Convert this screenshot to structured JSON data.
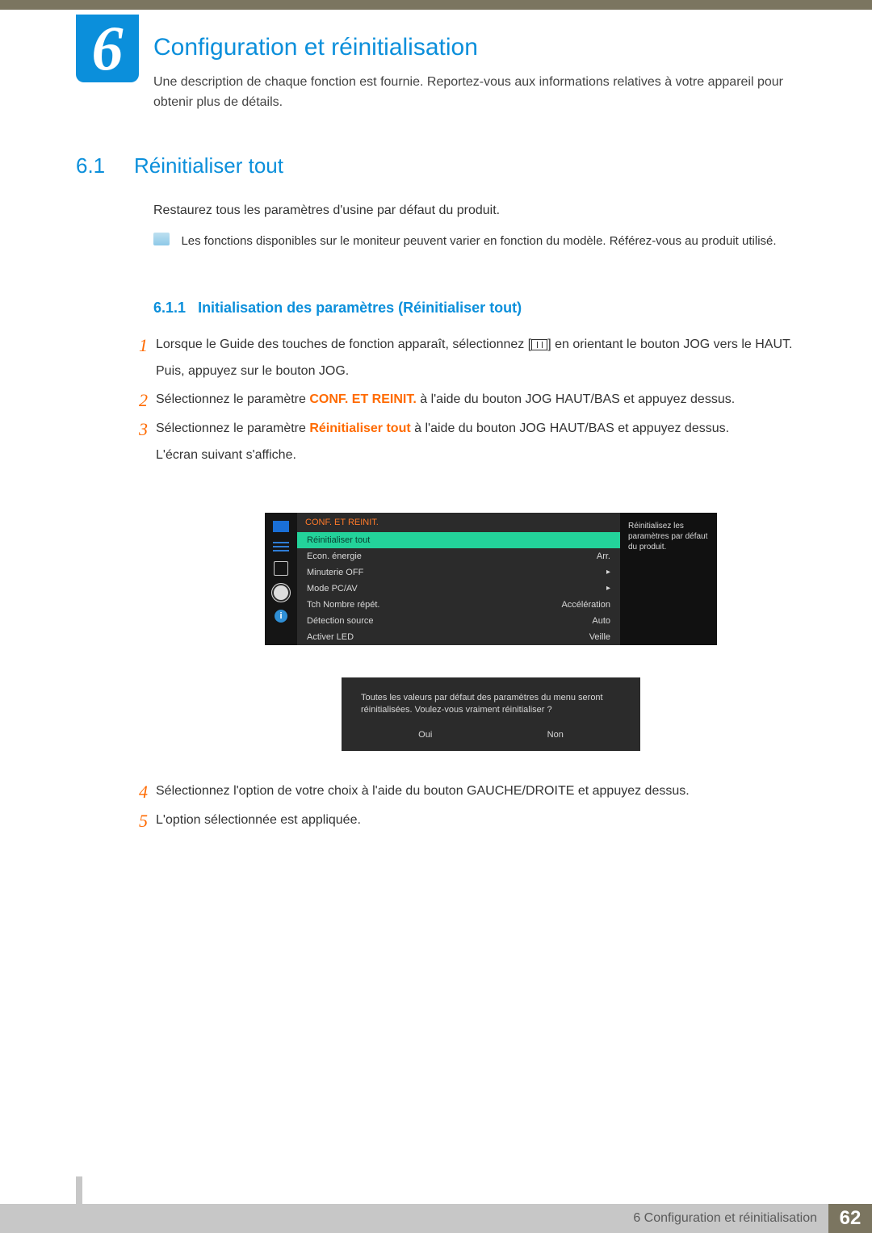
{
  "chapter": {
    "number": "6",
    "title": "Configuration et réinitialisation",
    "description": "Une description de chaque fonction est fournie. Reportez-vous aux informations relatives à votre appareil pour obtenir plus de détails."
  },
  "section": {
    "number": "6.1",
    "title": "Réinitialiser tout",
    "description": "Restaurez tous les paramètres d'usine par défaut du produit.",
    "note": "Les fonctions disponibles sur le moniteur peuvent varier en fonction du modèle. Référez-vous au produit utilisé."
  },
  "subsection": {
    "number": "6.1.1",
    "title": "Initialisation des paramètres (Réinitialiser tout)"
  },
  "steps": {
    "s1a": "Lorsque le Guide des touches de fonction apparaît, sélectionnez [",
    "s1b": "] en orientant le bouton JOG vers le HAUT.",
    "s1c": "Puis, appuyez sur le bouton JOG.",
    "s2a": "Sélectionnez le paramètre ",
    "s2b": "CONF. ET REINIT.",
    "s2c": " à l'aide du bouton JOG HAUT/BAS et appuyez dessus.",
    "s3a": "Sélectionnez le paramètre ",
    "s3b": "Réinitialiser tout",
    "s3c": " à l'aide du bouton JOG HAUT/BAS et appuyez dessus.",
    "s3d": "L'écran suivant s'affiche.",
    "s4": "Sélectionnez l'option de votre choix à l'aide du bouton GAUCHE/DROITE et appuyez dessus.",
    "s5": "L'option sélectionnée est appliquée."
  },
  "osd": {
    "header": "CONF. ET REINIT.",
    "rows": [
      {
        "label": "Réinitialiser tout",
        "value": ""
      },
      {
        "label": "Econ. énergie",
        "value": "Arr."
      },
      {
        "label": "Minuterie OFF",
        "value": "▸"
      },
      {
        "label": "Mode PC/AV",
        "value": "▸"
      },
      {
        "label": "Tch Nombre répét.",
        "value": "Accélération"
      },
      {
        "label": "Détection source",
        "value": "Auto"
      },
      {
        "label": "Activer LED",
        "value": "Veille"
      }
    ],
    "tooltip": "Réinitialisez les paramètres par défaut du produit.",
    "dialog": {
      "message": "Toutes les valeurs par défaut des paramètres du menu seront réinitialisées. Voulez-vous vraiment réinitialiser ?",
      "yes": "Oui",
      "no": "Non"
    }
  },
  "footer": {
    "label": "6 Configuration et réinitialisation",
    "page": "62"
  }
}
